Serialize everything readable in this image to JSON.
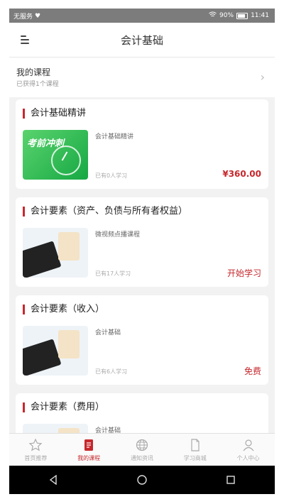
{
  "status_bar": {
    "carrier": "无服务",
    "battery": "90%",
    "time": "11:41"
  },
  "header": {
    "title": "会计基础",
    "menu_icon": "menu-icon"
  },
  "my_courses": {
    "title": "我的课程",
    "subtitle": "已获得1个课程",
    "chevron_icon": "chevron-right-icon"
  },
  "courses": [
    {
      "title": "会计基础精讲",
      "description": "会计基础精讲",
      "learners": "已有0人学习",
      "price": "¥360.00",
      "thumb_text": "考前冲刺",
      "thumb": "green-banner"
    },
    {
      "title": "会计要素（资产、负债与所有者权益）",
      "description": "微视频点播课程",
      "learners": "已有17人学习",
      "price": "开始学习",
      "thumb": "calculator-photo"
    },
    {
      "title": "会计要素（收入）",
      "description": "会计基础",
      "learners": "已有6人学习",
      "price": "免费",
      "thumb": "calculator-photo"
    },
    {
      "title": "会计要素（费用）",
      "description": "会计基础",
      "thumb": "calculator-photo"
    }
  ],
  "tabs": [
    {
      "label": "首页推荐",
      "icon": "star-icon",
      "active": false
    },
    {
      "label": "我的课程",
      "icon": "course-book-icon",
      "active": true
    },
    {
      "label": "通知资讯",
      "icon": "globe-icon",
      "active": false
    },
    {
      "label": "学习商城",
      "icon": "document-icon",
      "active": false
    },
    {
      "label": "个人中心",
      "icon": "user-icon",
      "active": false
    }
  ],
  "colors": {
    "accent": "#c6282d",
    "status_bar": "#7c7c7c",
    "background": "#f2f2f2"
  }
}
